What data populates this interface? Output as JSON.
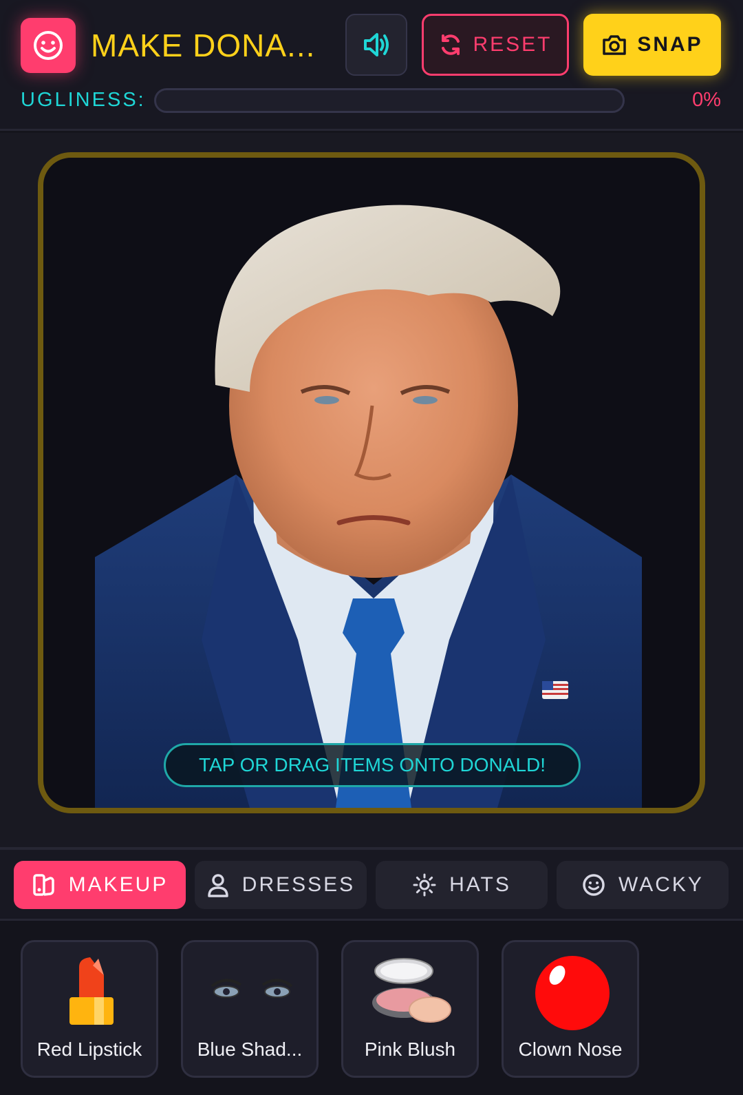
{
  "header": {
    "title": "MAKE DONA...",
    "reset_label": "RESET",
    "snap_label": "SNAP",
    "icons": {
      "logo": "smile-icon",
      "sound": "volume-icon",
      "reset": "refresh-icon",
      "snap": "camera-icon"
    }
  },
  "ugliness": {
    "label": "UGLINESS:",
    "value_text": "0%",
    "percent": 0
  },
  "stage": {
    "hint": "TAP OR DRAG ITEMS ONTO DONALD!"
  },
  "tabs": [
    {
      "label": "MAKEUP",
      "icon": "palette-icon",
      "active": true
    },
    {
      "label": "DRESSES",
      "icon": "person-icon",
      "active": false
    },
    {
      "label": "HATS",
      "icon": "sun-icon",
      "active": false
    },
    {
      "label": "WACKY",
      "icon": "smile-icon",
      "active": false
    }
  ],
  "items": [
    {
      "label": "Red Lipstick",
      "icon": "lipstick-icon"
    },
    {
      "label": "Blue Shad...",
      "icon": "eyeshadow-icon"
    },
    {
      "label": "Pink Blush",
      "icon": "blush-compact-icon"
    },
    {
      "label": "Clown Nose",
      "icon": "clown-nose-icon"
    }
  ],
  "colors": {
    "accent_pink": "#ff3d6e",
    "accent_yellow": "#ffd11a",
    "accent_cyan": "#1fd6d6",
    "background": "#14141c"
  }
}
